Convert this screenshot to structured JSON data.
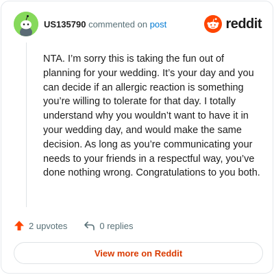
{
  "header": {
    "username": "US135790",
    "action_text": "commented on",
    "post_link": "post",
    "brand_name": "reddit"
  },
  "comment": {
    "body": "NTA. I’m sorry this is taking the fun out of planning for your wedding. It’s your day and you can decide if an allergic reaction is something you’re willing to tolerate for that day. I totally understand why you wouldn’t want to have it in your wedding day, and would make the same decision. As long as you’re communicating your needs to your friends in a respectful way, you’ve done nothing wrong. Congratulations to you both."
  },
  "actions": {
    "upvotes_label": "2 upvotes",
    "replies_label": "0 replies"
  },
  "footer": {
    "view_button_label": "View more on Reddit"
  },
  "colors": {
    "accent": "#d93a00",
    "brand": "#ff4500",
    "avatar_bg": "#86d95b",
    "link": "#0079d3"
  },
  "icons": [
    "avatar-snoo-icon",
    "reddit-logo-icon",
    "upvote-arrow-icon",
    "reply-arrow-icon"
  ]
}
